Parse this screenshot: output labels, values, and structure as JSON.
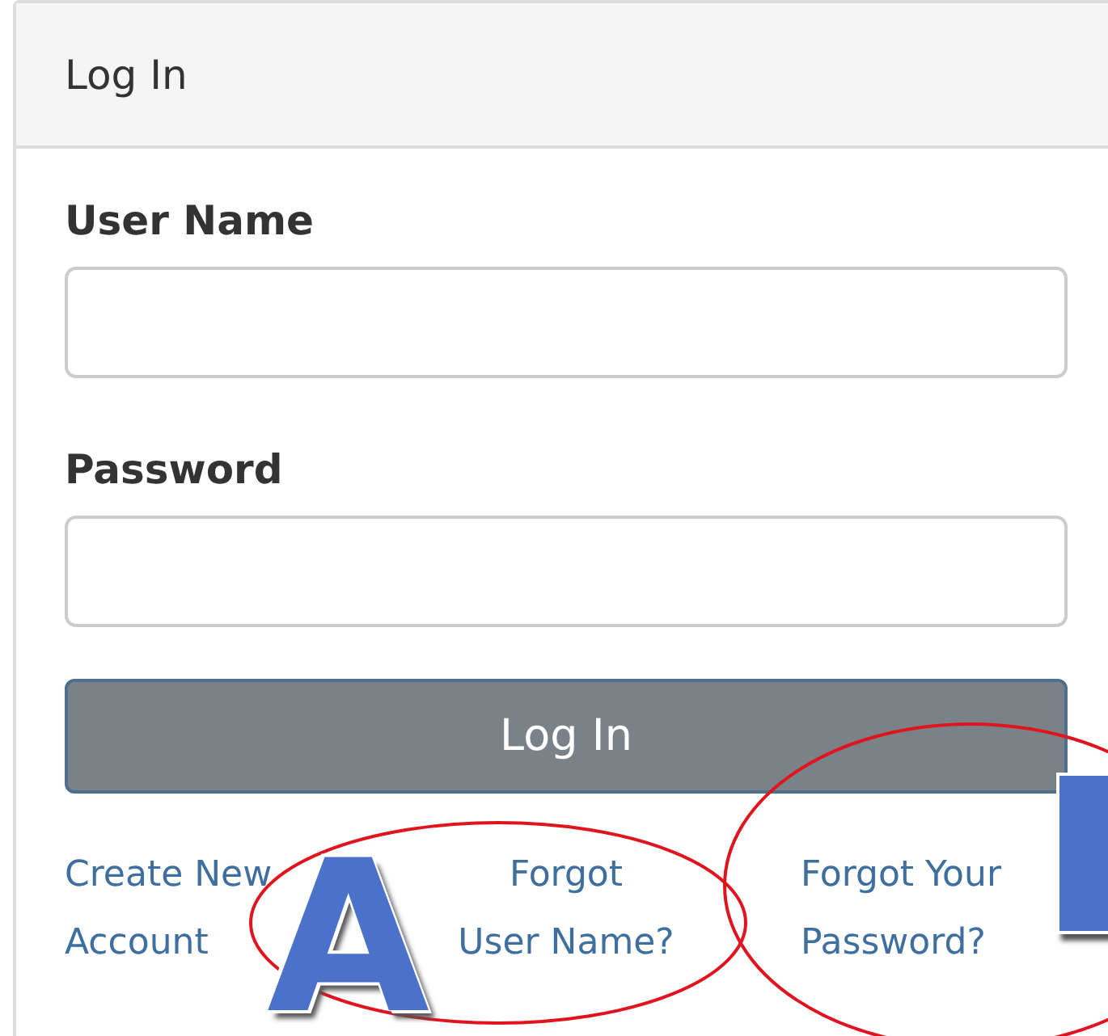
{
  "panel": {
    "title": "Log In"
  },
  "fields": [
    {
      "label": "User Name"
    },
    {
      "label": "Password"
    }
  ],
  "submit": "Log In",
  "links": [
    {
      "text": "Create New\nAccount"
    },
    {
      "text": "Forgot\nUser Name?"
    },
    {
      "text": "Forgot Your\nPassword?"
    }
  ],
  "annotations": [
    {
      "kind": "letter",
      "label": "A"
    },
    {
      "kind": "cut-mark"
    }
  ]
}
